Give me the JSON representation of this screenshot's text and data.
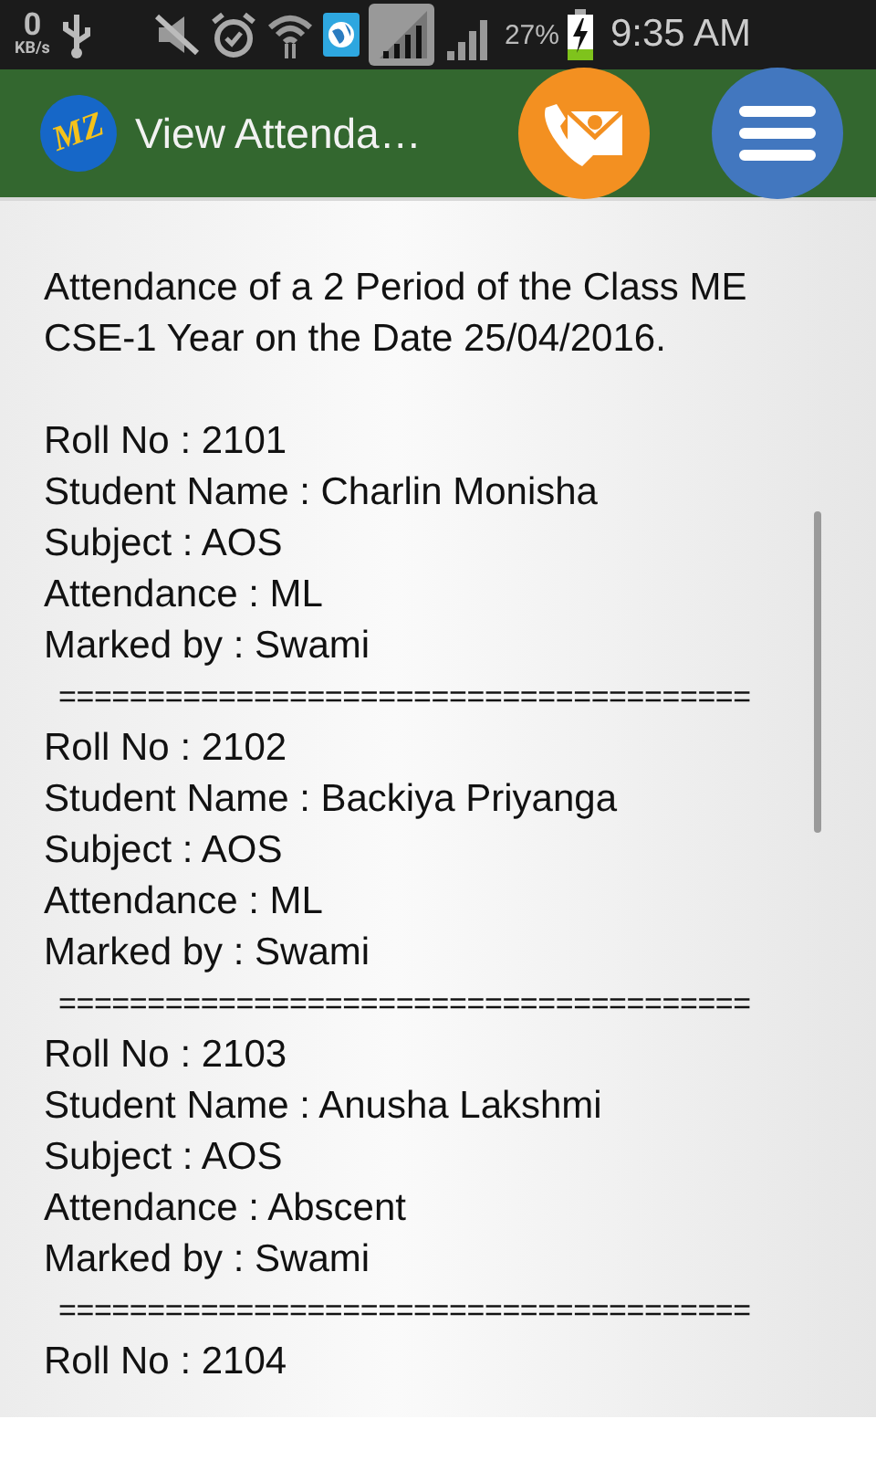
{
  "status_bar": {
    "speed_value": "0",
    "speed_unit": "KB/s",
    "battery": "27%",
    "time": "9:35 AM"
  },
  "header": {
    "logo_text": "MZ",
    "title": "View Attenda…"
  },
  "content": {
    "intro": "Attendance of a 2 Period of the Class ME CSE-1 Year on the Date 25/04/2016.",
    "records": [
      {
        "lines": [
          "Roll No : 2101",
          "Student Name : Charlin Monisha",
          "Subject : AOS",
          "Attendance : ML",
          "Marked by : Swami"
        ],
        "separator": "======================================="
      },
      {
        "lines": [
          "Roll No : 2102",
          "Student Name : Backiya Priyanga",
          "Subject : AOS",
          "Attendance : ML",
          "Marked by : Swami"
        ],
        "separator": "======================================="
      },
      {
        "lines": [
          "Roll No : 2103",
          "Student Name : Anusha Lakshmi",
          "Subject : AOS",
          "Attendance : Abscent",
          "Marked by : Swami"
        ],
        "separator": "======================================="
      },
      {
        "lines": [
          "Roll No : 2104"
        ]
      }
    ]
  }
}
